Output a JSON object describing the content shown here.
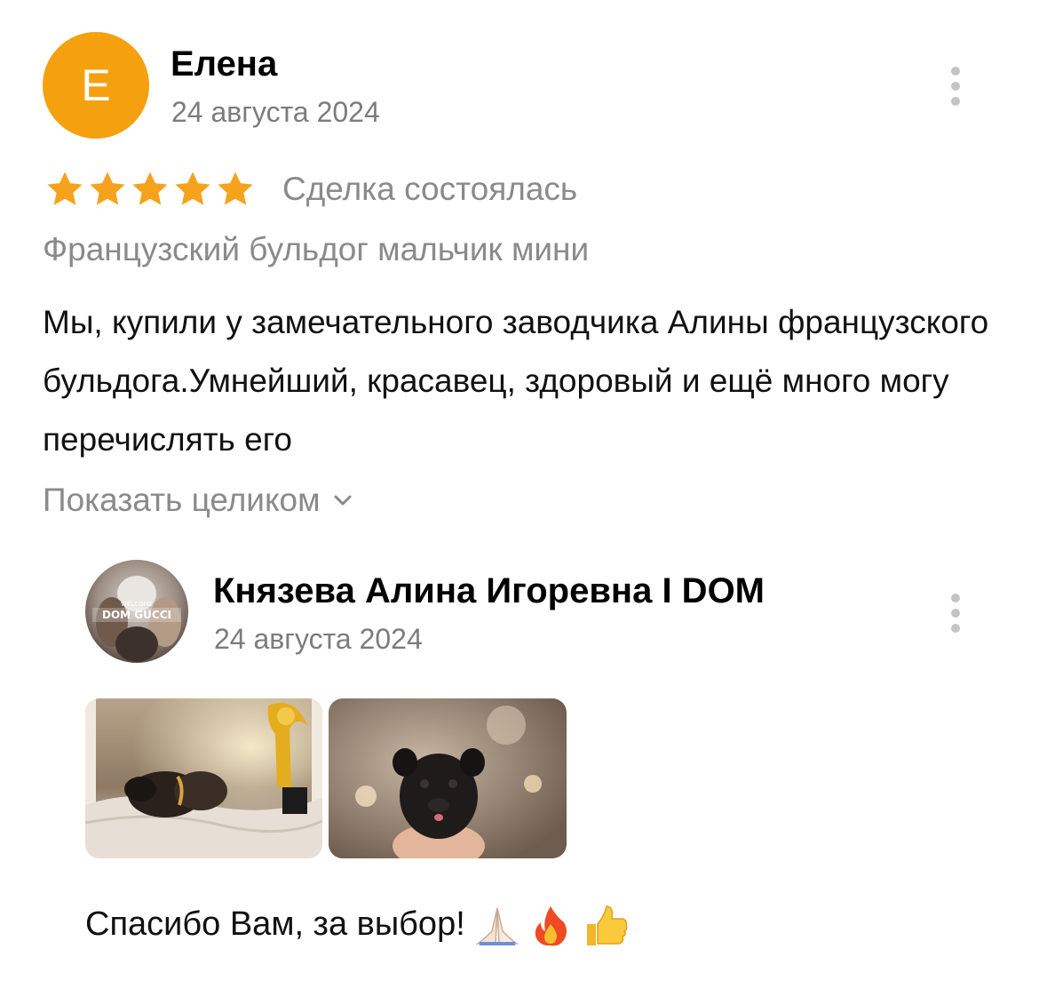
{
  "review": {
    "avatar_letter": "Е",
    "author": "Елена",
    "date": "24 августа 2024",
    "rating": 5,
    "status": "Сделка состоялась",
    "item_title": "Французский бульдог мальчик мини",
    "text": "Мы, купили у замечательного заводчика Алины французского бульдога.Умнейший, красавец, здоровый и ещё много могу перечислять его",
    "show_more_label": "Показать целиком",
    "star_color": "#f6a21d",
    "avatar_color": "#f5a00f"
  },
  "reply": {
    "author": "Князева Алина Игоревна I DOM",
    "date": "24 августа 2024",
    "avatar_text": "DOM GUCCI",
    "avatar_subtext": "WELCOME",
    "photos": [
      "puppy-with-trophy-photo",
      "puppy-in-hand-photo"
    ],
    "text": "Спасибо Вам, за выбор!",
    "emojis": [
      "folded-hands-icon",
      "fire-icon",
      "thumbs-up-icon"
    ]
  }
}
